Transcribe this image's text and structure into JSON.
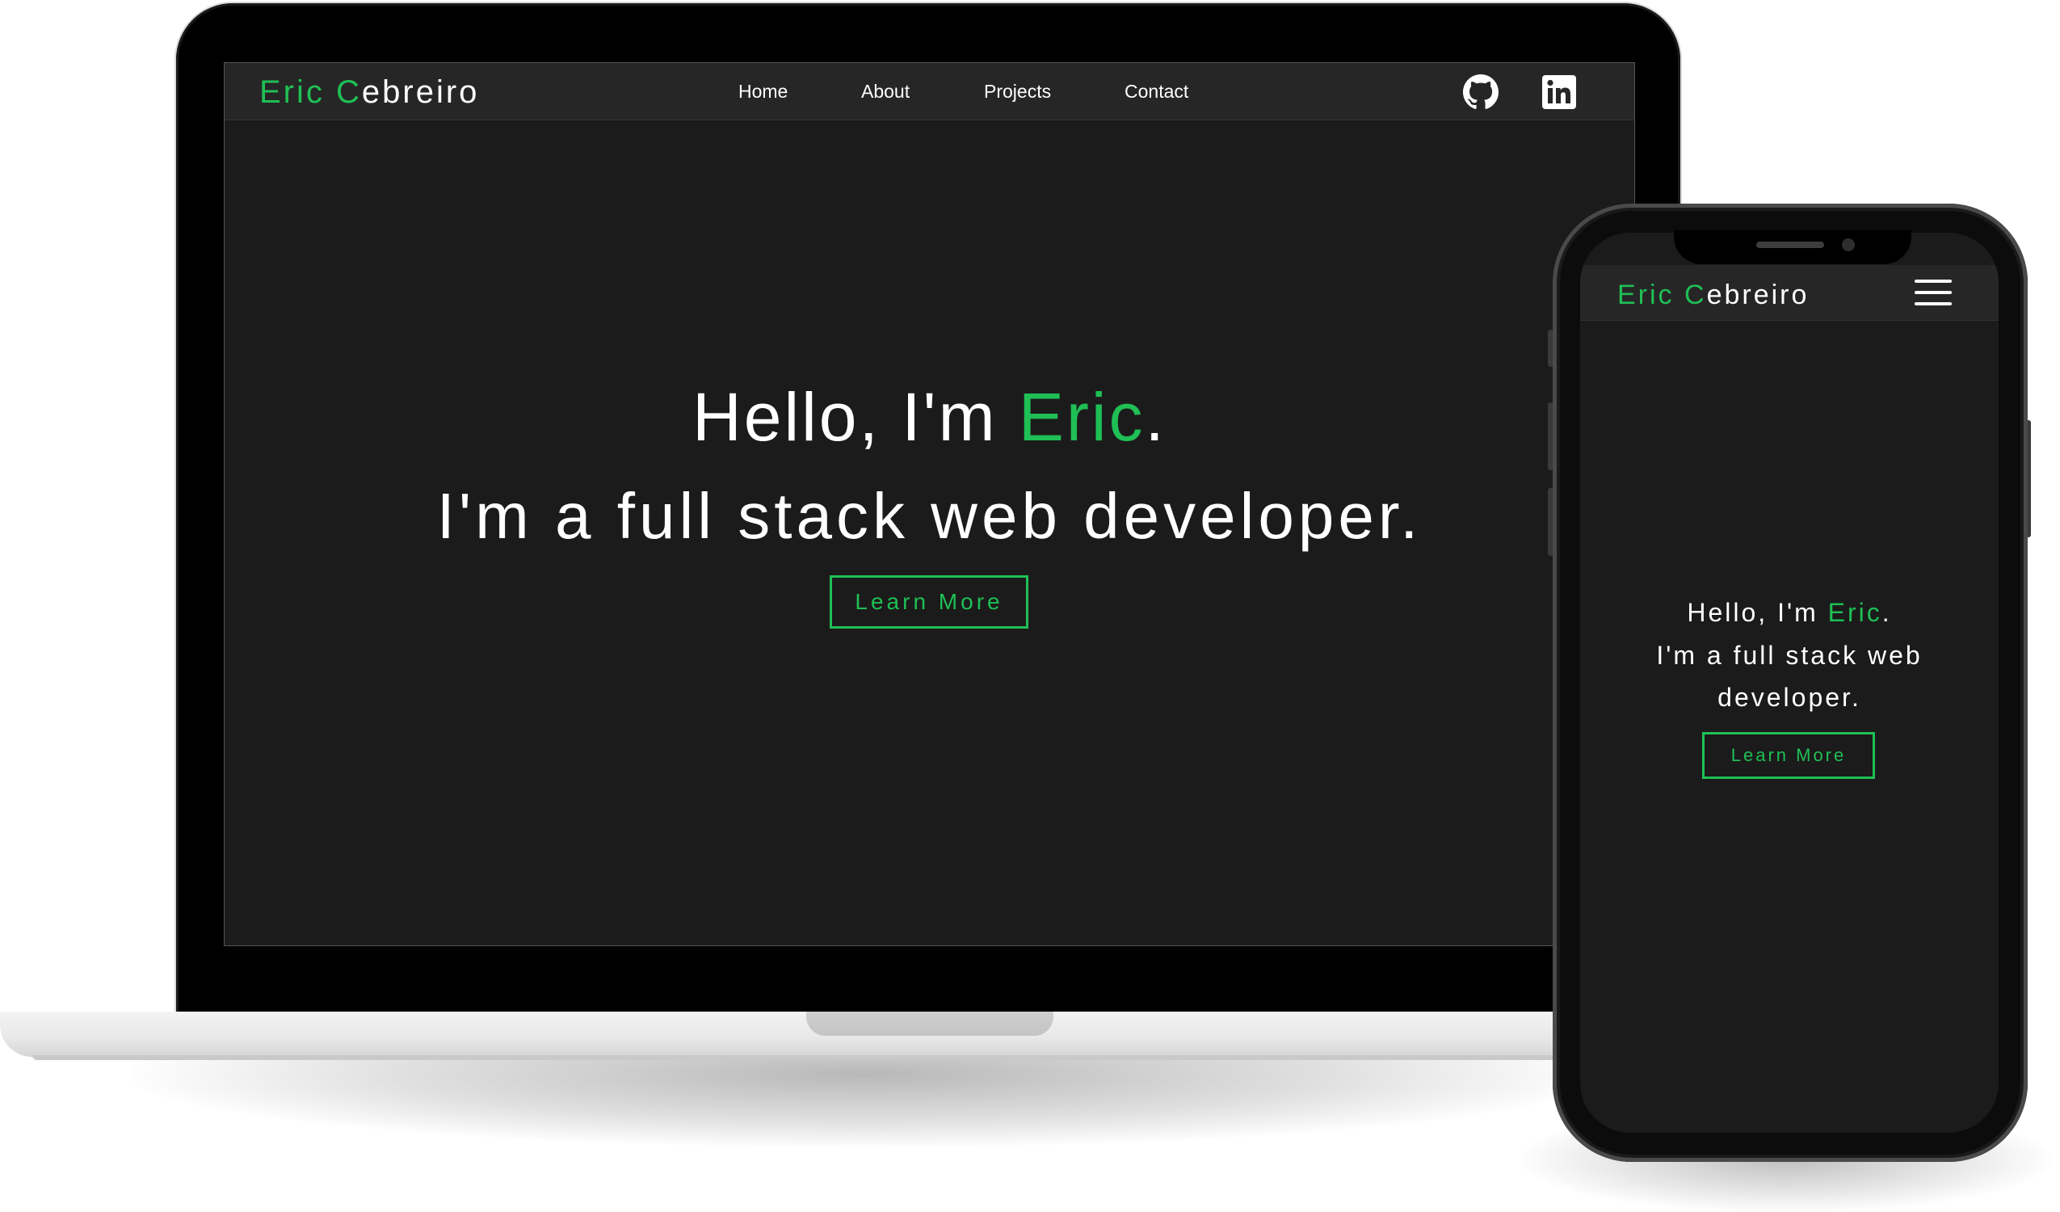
{
  "brand": {
    "first": "Eric ",
    "initial": "C",
    "rest": "ebreiro"
  },
  "nav": {
    "home": "Home",
    "about": "About",
    "projects": "Projects",
    "contact": "Contact"
  },
  "hero": {
    "greeting_pre": "Hello, I'm ",
    "name": "Eric",
    "greeting_post": ".",
    "tagline": "I'm a full stack web developer.",
    "mobile_tagline_1": "I'm a full stack web",
    "mobile_tagline_2": "developer.",
    "cta": "Learn More"
  },
  "icons": {
    "github": "github-icon",
    "linkedin": "linkedin-icon",
    "menu": "hamburger-menu-icon"
  },
  "colors": {
    "accent": "#1fbf55",
    "background": "#1b1b1b",
    "navbar": "#262626",
    "text": "#ffffff"
  }
}
